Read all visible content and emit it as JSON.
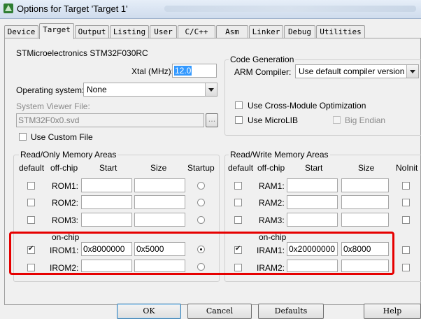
{
  "window": {
    "title": "Options for Target 'Target 1'"
  },
  "tabs": [
    "Device",
    "Target",
    "Output",
    "Listing",
    "User",
    "C/C++",
    "Asm",
    "Linker",
    "Debug",
    "Utilities"
  ],
  "active_tab": "Target",
  "device_name": "STMicroelectronics STM32F030RC",
  "xtal": {
    "label": "Xtal (MHz):",
    "value": "12.0"
  },
  "os": {
    "label": "Operating system:",
    "value": "None"
  },
  "svd": {
    "label": "System Viewer File:",
    "value": "STM32F0x0.svd",
    "browse": "..."
  },
  "custom_file": {
    "label": "Use Custom File",
    "checked": false
  },
  "code_gen": {
    "title": "Code Generation",
    "compiler_label": "ARM Compiler:",
    "compiler_value": "Use default compiler version",
    "cross_module": "Use Cross-Module Optimization",
    "microlib": "Use MicroLIB",
    "big_endian": "Big Endian"
  },
  "rom": {
    "title": "Read/Only Memory Areas",
    "headers": {
      "default": "default",
      "offchip": "off-chip",
      "start": "Start",
      "size": "Size",
      "startup": "Startup"
    },
    "rows": [
      {
        "name": "ROM1:",
        "start": "",
        "size": "",
        "default": false,
        "startup": false
      },
      {
        "name": "ROM2:",
        "start": "",
        "size": "",
        "default": false,
        "startup": false
      },
      {
        "name": "ROM3:",
        "start": "",
        "size": "",
        "default": false,
        "startup": false
      }
    ],
    "onchip_label": "on-chip",
    "onchip_rows": [
      {
        "name": "IROM1:",
        "start": "0x8000000",
        "size": "0x5000",
        "default": true,
        "startup": true
      },
      {
        "name": "IROM2:",
        "start": "",
        "size": "",
        "default": false,
        "startup": false
      }
    ]
  },
  "ram": {
    "title": "Read/Write Memory Areas",
    "headers": {
      "default": "default",
      "offchip": "off-chip",
      "start": "Start",
      "size": "Size",
      "noinit": "NoInit"
    },
    "rows": [
      {
        "name": "RAM1:",
        "start": "",
        "size": "",
        "default": false,
        "noinit": false
      },
      {
        "name": "RAM2:",
        "start": "",
        "size": "",
        "default": false,
        "noinit": false
      },
      {
        "name": "RAM3:",
        "start": "",
        "size": "",
        "default": false,
        "noinit": false
      }
    ],
    "onchip_label": "on-chip",
    "onchip_rows": [
      {
        "name": "IRAM1:",
        "start": "0x20000000",
        "size": "0x8000",
        "default": true,
        "noinit": false
      },
      {
        "name": "IRAM2:",
        "start": "",
        "size": "",
        "default": false,
        "noinit": false
      }
    ]
  },
  "buttons": {
    "ok": "OK",
    "cancel": "Cancel",
    "defaults": "Defaults",
    "help": "Help"
  },
  "colors": {
    "highlight_box": "#e60000",
    "selection": "#3399ff"
  }
}
